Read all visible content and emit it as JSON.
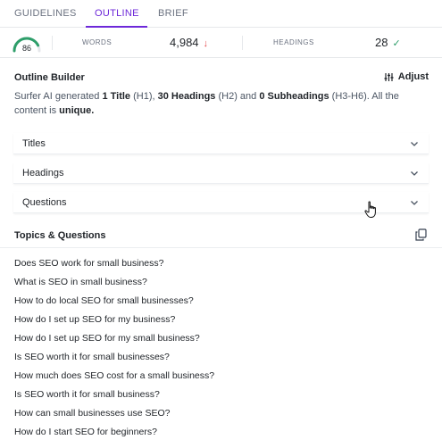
{
  "tabs": [
    {
      "label": "GUIDELINES"
    },
    {
      "label": "OUTLINE",
      "active": true
    },
    {
      "label": "BRIEF"
    }
  ],
  "metrics": {
    "score": "86",
    "score_fraction": 0.86,
    "words_label": "WORDS",
    "words_value": "4,984",
    "words_trend": "↓",
    "headings_label": "HEADINGS",
    "headings_value": "28",
    "headings_status": "✓"
  },
  "outline_builder": {
    "title": "Outline Builder",
    "adjust_label": "Adjust",
    "desc_prefix": "Surfer AI generated ",
    "desc_titles_count": "1 Title",
    "desc_h1": " (H1), ",
    "desc_headings_count": "30 Headings",
    "desc_h2": " (H2) and ",
    "desc_subheadings_count": "0 Subheadings",
    "desc_h3": " (H3-H6). All the content is ",
    "desc_unique": "unique.",
    "sections": [
      {
        "label": "Titles"
      },
      {
        "label": "Headings"
      },
      {
        "label": "Questions"
      }
    ]
  },
  "topics": {
    "title": "Topics & Questions",
    "questions": [
      "Does SEO work for small business?",
      "What is SEO in small business?",
      "How to do local SEO for small businesses?",
      "How do I set up SEO for my business?",
      "How do I set up SEO for my small business?",
      "Is SEO worth it for small businesses?",
      "How much does SEO cost for a small business?",
      "Is SEO worth it for small business?",
      "How can small businesses use SEO?",
      "How do I start SEO for beginners?"
    ]
  },
  "colors": {
    "accent": "#6d28d9",
    "gauge": "#2e9e6a",
    "trend_down": "#e5484d"
  }
}
